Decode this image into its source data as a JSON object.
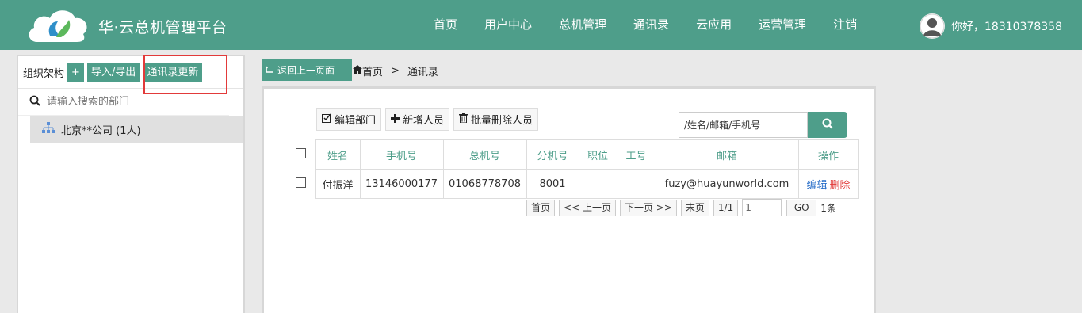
{
  "header": {
    "brand": "华·云总机管理平台",
    "nav": [
      "首页",
      "用户中心",
      "总机管理",
      "通讯录",
      "云应用",
      "运营管理",
      "注销"
    ],
    "greeting": "你好，18310378358",
    "bg_color": "#4e9e8a"
  },
  "left": {
    "org_label": "组织架构",
    "add_label": "+",
    "import_export_label": "导入/导出",
    "update_label": "通讯录更新",
    "search_placeholder": "请输入搜索的部门",
    "tree_node": "北京**公司 (1人)"
  },
  "breadcrumb": {
    "back_label": "返回上一页面",
    "home": "首页",
    "sep": ">",
    "current": "通讯录"
  },
  "toolbar": {
    "edit_dept": "编辑部门",
    "add_person": "新增人员",
    "batch_delete": "批量删除人员"
  },
  "search": {
    "value": "/姓名/邮箱/手机号"
  },
  "table": {
    "headers": [
      "姓名",
      "手机号",
      "总机号",
      "分机号",
      "职位",
      "工号",
      "邮箱",
      "操作"
    ],
    "rows": [
      {
        "name": "付振洋",
        "mobile": "13146000177",
        "main_number": "01068778708",
        "extension": "8001",
        "position": "",
        "employee_id": "",
        "email": "fuzy@huayunworld.com",
        "edit": "编辑",
        "delete": "删除"
      }
    ]
  },
  "pager": {
    "first": "首页",
    "prev": "<< 上一页",
    "next": "下一页 >>",
    "last": "末页",
    "page_info": "1/1",
    "page_input": "1",
    "go": "GO",
    "count": "1条"
  }
}
